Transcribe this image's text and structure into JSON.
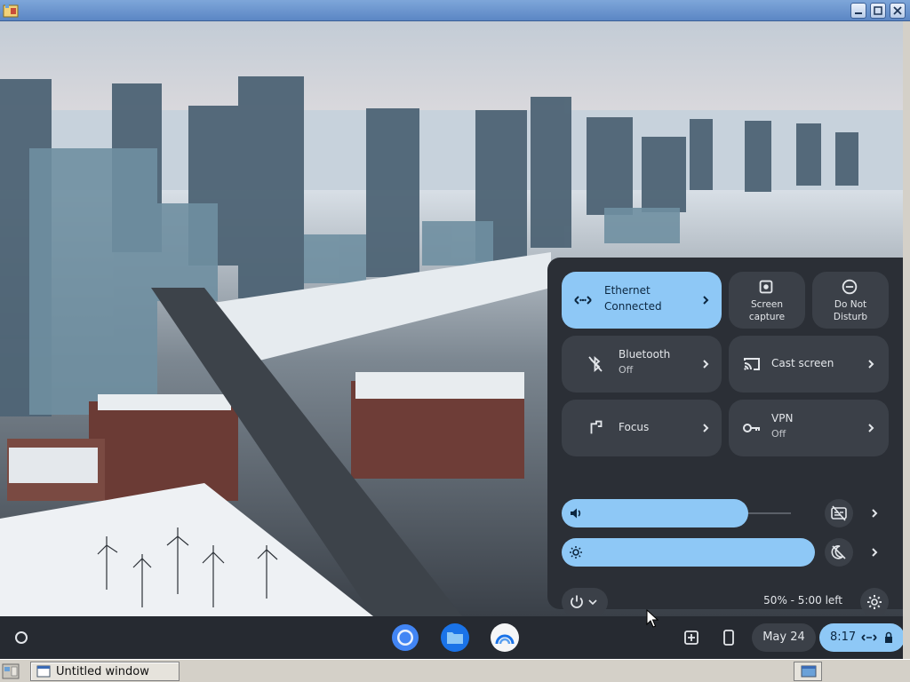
{
  "window": {
    "title": ""
  },
  "quick_settings": {
    "ethernet": {
      "label": "Ethernet",
      "status": "Connected",
      "icon": "ethernet-icon"
    },
    "screen_capture": {
      "label_line1": "Screen",
      "label_line2": "capture",
      "icon": "screen-capture-icon"
    },
    "do_not_disturb": {
      "label_line1": "Do Not",
      "label_line2": "Disturb",
      "icon": "do-not-disturb-icon"
    },
    "bluetooth": {
      "label": "Bluetooth",
      "status": "Off",
      "icon": "bluetooth-off-icon"
    },
    "cast_screen": {
      "label": "Cast screen",
      "icon": "cast-icon"
    },
    "focus": {
      "label": "Focus",
      "icon": "focus-icon"
    },
    "vpn": {
      "label": "VPN",
      "status": "Off",
      "icon": "vpn-key-icon"
    },
    "volume": {
      "level": 0.73,
      "icon": "volume-icon"
    },
    "brightness": {
      "level": 0.99,
      "icon": "brightness-icon"
    },
    "battery_text": "50% - 5:00 left"
  },
  "shelf": {
    "apps": [
      "chrome-icon",
      "files-icon",
      "web-store-icon"
    ],
    "date": "May 24",
    "time": "8:17"
  },
  "taskbar": {
    "item_label": "Untitled window"
  },
  "colors": {
    "accent": "#8ec8f6",
    "panel": "#2b2f36",
    "tile": "#3b4048",
    "shelf": "#262a31"
  }
}
